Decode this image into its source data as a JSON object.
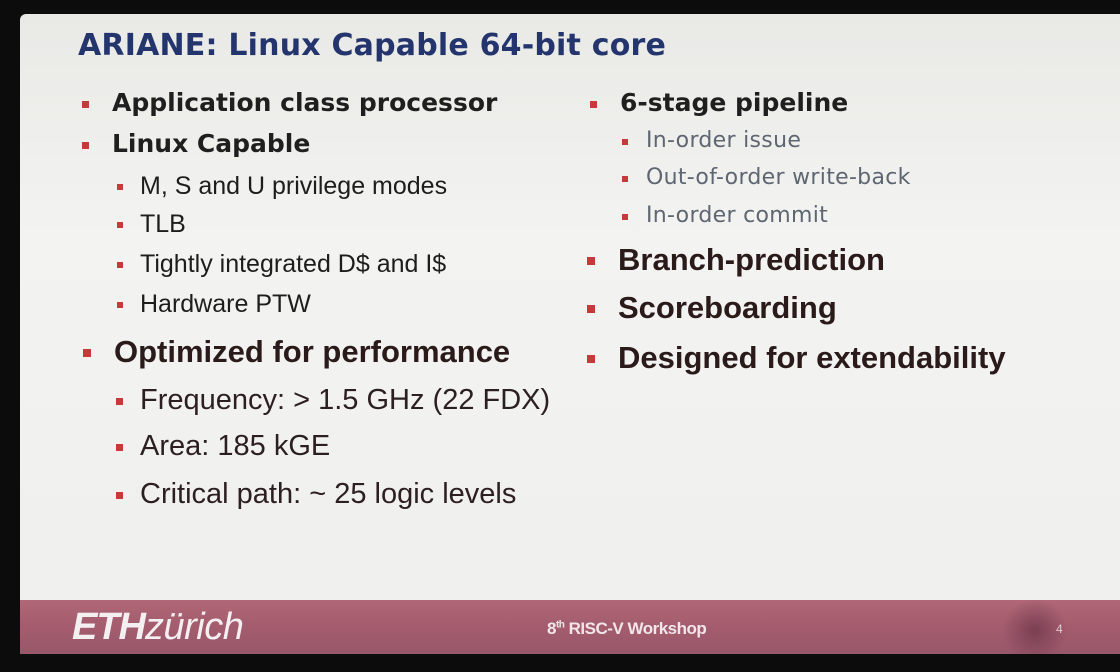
{
  "slide": {
    "title": "ARIANE: Linux Capable 64-bit core",
    "left_column": [
      {
        "label": "Application class processor",
        "level": 1
      },
      {
        "label": "Linux Capable",
        "level": 1
      },
      {
        "label": "M, S and U privilege modes",
        "level": 2
      },
      {
        "label": "TLB",
        "level": 2
      },
      {
        "label": "Tightly integrated D$ and I$",
        "level": 2
      },
      {
        "label": "Hardware PTW",
        "level": 2
      },
      {
        "label": "Optimized for performance",
        "level": 1
      },
      {
        "label": "Frequency: > 1.5 GHz (22 FDX)",
        "level": 2
      },
      {
        "label": "Area: 185 kGE",
        "level": 2
      },
      {
        "label": "Critical path: ~ 25 logic levels",
        "level": 2
      }
    ],
    "right_column": [
      {
        "label": "6-stage pipeline",
        "level": 1
      },
      {
        "label": "In-order issue",
        "level": 2
      },
      {
        "label": "Out-of-order write-back",
        "level": 2
      },
      {
        "label": "In-order commit",
        "level": 2
      },
      {
        "label": "Branch-prediction",
        "level": 1
      },
      {
        "label": "Scoreboarding",
        "level": 1
      },
      {
        "label": "Designed for extendability",
        "level": 1
      }
    ],
    "footer": {
      "logo_bold": "ETH",
      "logo_rest": "zürich",
      "event_prefix": "8",
      "event_sup": "th",
      "event_name": " RISC-V Workshop",
      "page_number": "4"
    },
    "colors": {
      "title": "#24356e",
      "bullet_square": "#c63a3a",
      "footer_band": "#a35c6d"
    }
  }
}
